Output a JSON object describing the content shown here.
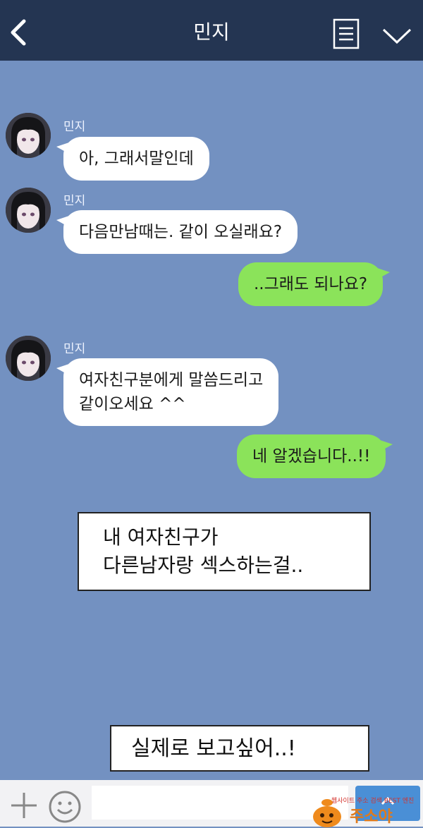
{
  "header": {
    "title": "민지"
  },
  "contact_name": "민지",
  "messages": [
    {
      "from": "contact",
      "name": "민지",
      "lines": [
        "아, 그래서말인데"
      ]
    },
    {
      "from": "contact",
      "name": "민지",
      "lines": [
        "다음만남때는. 같이 오실래요?"
      ]
    },
    {
      "from": "me",
      "lines": [
        "..그래도 되나요?"
      ]
    },
    {
      "from": "contact",
      "name": "민지",
      "lines": [
        "여자친구분에게 말씀드리고",
        "같이오세요 ^^"
      ]
    },
    {
      "from": "me",
      "lines": [
        "네 알겠습니다..!!"
      ]
    }
  ],
  "captions": [
    {
      "lines": [
        "내 여자친구가",
        "다른남자랑 섹스하는걸.."
      ]
    },
    {
      "lines": [
        "실제로 보고싶어..!"
      ]
    }
  ],
  "input_bar": {
    "placeholder": ""
  },
  "watermark": {
    "top": "웹사이트 주소 검색 BEST 엔진",
    "brand": "주소야"
  },
  "colors": {
    "header": "#243552",
    "background": "#7391c1",
    "incoming_bubble": "#ffffff",
    "outgoing_bubble": "#8be35a",
    "send_button": "#4a8fd6"
  }
}
